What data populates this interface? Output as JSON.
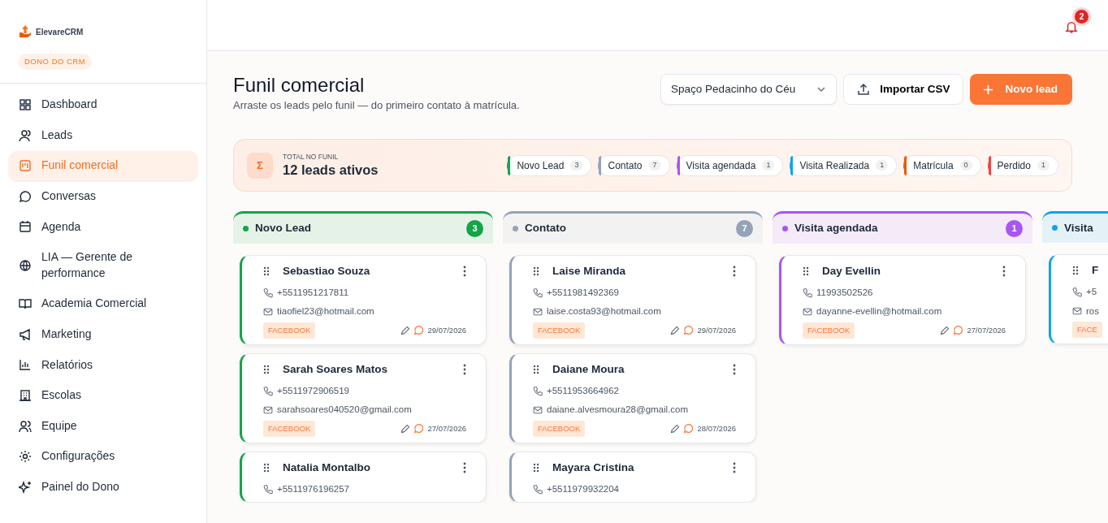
{
  "brand": {
    "name": "ElevareCRM",
    "role_badge": "DONO DO CRM"
  },
  "sidebar": {
    "items": [
      {
        "label": "Dashboard",
        "selected": false
      },
      {
        "label": "Leads",
        "selected": false
      },
      {
        "label": "Funil comercial",
        "selected": true
      },
      {
        "label": "Conversas",
        "selected": false
      },
      {
        "label": "Agenda",
        "selected": false
      },
      {
        "label": "LIA — Gerente de performance",
        "selected": false
      },
      {
        "label": "Academia Comercial",
        "selected": false
      },
      {
        "label": "Marketing",
        "selected": false
      },
      {
        "label": "Relatórios",
        "selected": false
      },
      {
        "label": "Escolas",
        "selected": false
      },
      {
        "label": "Equipe",
        "selected": false
      },
      {
        "label": "Configurações",
        "selected": false
      },
      {
        "label": "Painel do Dono",
        "selected": false
      }
    ]
  },
  "topbar": {
    "notifications": "2"
  },
  "header": {
    "title": "Funil comercial",
    "subtitle": "Arraste os leads pelo funil — do primeiro contato à matrícula.",
    "school_select": "Spaço Pedacinho do Céu",
    "import_button": "Importar CSV",
    "new_button": "Novo lead"
  },
  "summary": {
    "label": "TOTAL NO FUNIL",
    "value": "12 leads ativos",
    "icon": "Σ",
    "stages": [
      {
        "label": "Novo Lead",
        "count": "3",
        "color": "#16a34a"
      },
      {
        "label": "Contato",
        "count": "7",
        "color": "#94a3b8"
      },
      {
        "label": "Visita agendada",
        "count": "1",
        "color": "#a855f7"
      },
      {
        "label": "Visita Realizada",
        "count": "1",
        "color": "#0ea5e9"
      },
      {
        "label": "Matrícula",
        "count": "0",
        "color": "#ea580c"
      },
      {
        "label": "Perdido",
        "count": "1",
        "color": "#ef4444"
      }
    ]
  },
  "columns": [
    {
      "title": "Novo Lead",
      "count": "3",
      "color": "#16a34a",
      "cards": [
        {
          "name": "Sebastiao Souza",
          "phone": "+5511951217811",
          "email": "tiaofiel23@hotmail.com",
          "source": "FACEBOOK",
          "date": "29/07/2026"
        },
        {
          "name": "Sarah Soares Matos",
          "phone": "+5511972906519",
          "email": "sarahsoares040520@gmail.com",
          "source": "FACEBOOK",
          "date": "27/07/2026"
        },
        {
          "name": "Natalia Montalbo",
          "phone": "+5511976196257"
        }
      ]
    },
    {
      "title": "Contato",
      "count": "7",
      "color": "#94a3b8",
      "cards": [
        {
          "name": "Laise Miranda",
          "phone": "+5511981492369",
          "email": "laise.costa93@hotmail.com",
          "source": "FACEBOOK",
          "date": "29/07/2026"
        },
        {
          "name": "Daiane Moura",
          "phone": "+5511953664962",
          "email": "daiane.alvesmoura28@gmail.com",
          "source": "FACEBOOK",
          "date": "28/07/2026"
        },
        {
          "name": "Mayara Cristina",
          "phone": "+5511979932204"
        }
      ]
    },
    {
      "title": "Visita agendada",
      "count": "1",
      "color": "#a855f7",
      "cards": [
        {
          "name": "Day Evellin",
          "phone": "11993502526",
          "email": "dayanne-evellin@hotmail.com",
          "source": "FACEBOOK",
          "date": "27/07/2026"
        }
      ]
    },
    {
      "title": "Visita",
      "color": "#0ea5e9",
      "cards": [
        {
          "name": "F",
          "phone": "+5",
          "email": "ros",
          "source": "FACE"
        }
      ]
    }
  ]
}
